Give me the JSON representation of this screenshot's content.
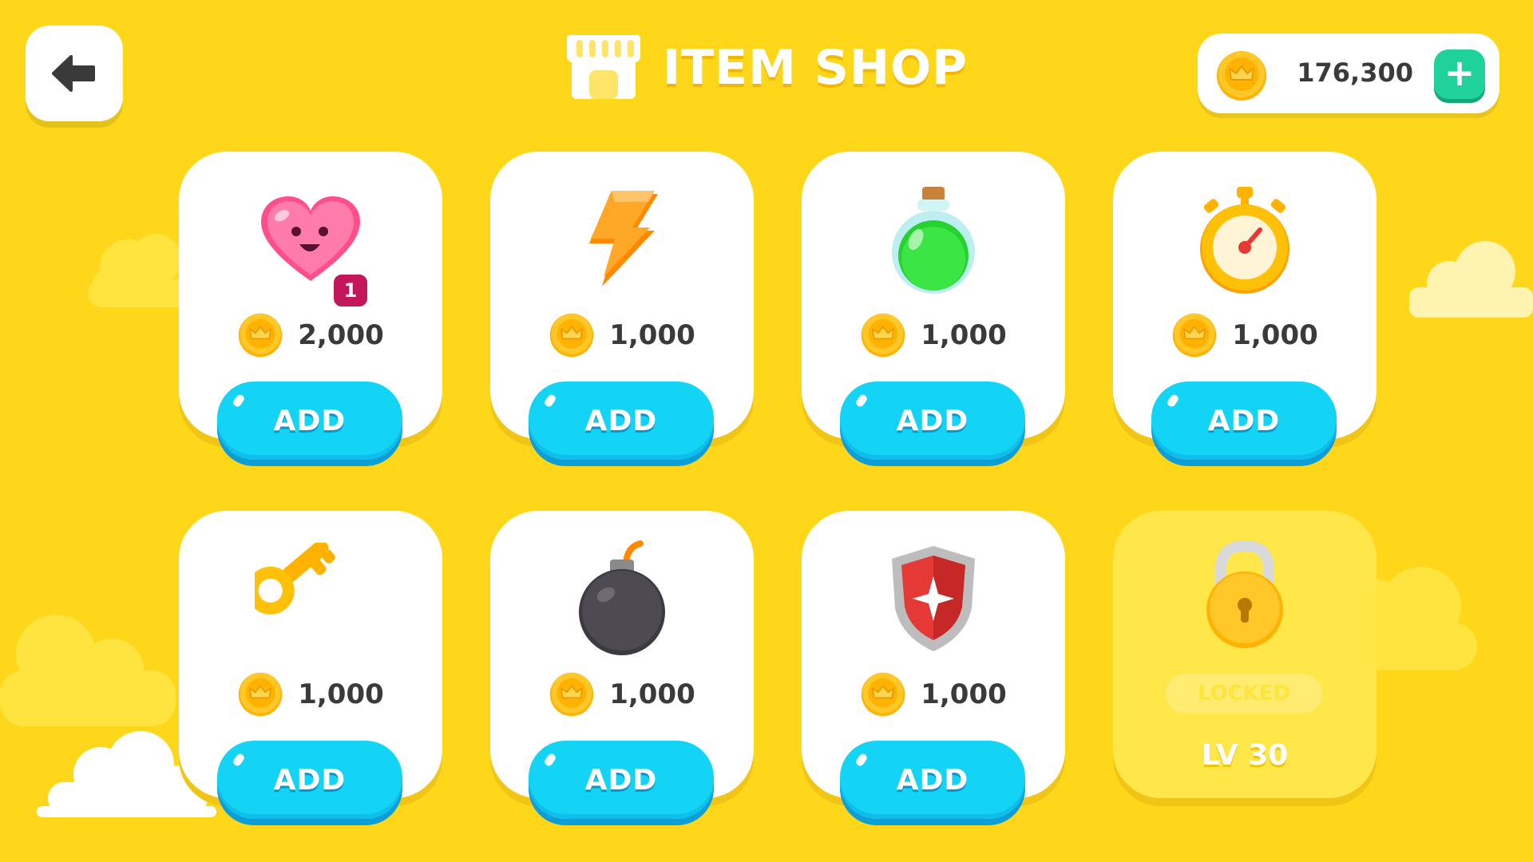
{
  "header": {
    "title": "ITEM SHOP",
    "icon": "shop-icon"
  },
  "back_button": {
    "icon": "back-arrow-icon"
  },
  "wallet": {
    "icon": "coin-icon",
    "amount": "176,300",
    "add_icon": "plus-icon"
  },
  "colors": {
    "background": "#FFD71A",
    "card": "#FFFFFF",
    "button": "#14D4F6",
    "plus_button": "#1FD29B",
    "coin": "#FFC20E"
  },
  "items": [
    {
      "icon": "heart-icon",
      "badge": "1",
      "price": "2,000",
      "button_label": "ADD"
    },
    {
      "icon": "lightning-icon",
      "price": "1,000",
      "button_label": "ADD"
    },
    {
      "icon": "potion-icon",
      "price": "1,000",
      "button_label": "ADD"
    },
    {
      "icon": "stopwatch-icon",
      "price": "1,000",
      "button_label": "ADD"
    },
    {
      "icon": "key-icon",
      "price": "1,000",
      "button_label": "ADD"
    },
    {
      "icon": "bomb-icon",
      "price": "1,000",
      "button_label": "ADD"
    },
    {
      "icon": "shield-icon",
      "price": "1,000",
      "button_label": "ADD"
    }
  ],
  "locked_item": {
    "icon": "padlock-icon",
    "status": "LOCKED",
    "level": "LV 30"
  }
}
